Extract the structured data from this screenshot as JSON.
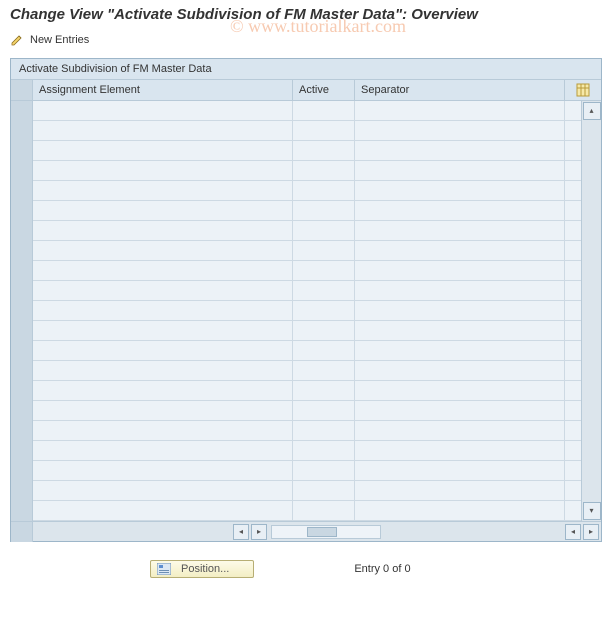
{
  "page_title": "Change View \"Activate Subdivision of FM Master Data\": Overview",
  "toolbar": {
    "new_entries_label": "New Entries"
  },
  "panel": {
    "title": "Activate Subdivision of FM Master Data",
    "columns": {
      "assignment": "Assignment Element",
      "active": "Active",
      "separator": "Separator"
    },
    "row_count": 21
  },
  "footer": {
    "position_label": "Position...",
    "entry_text": "Entry 0 of 0"
  },
  "watermark": "© www.tutorialkart.com"
}
